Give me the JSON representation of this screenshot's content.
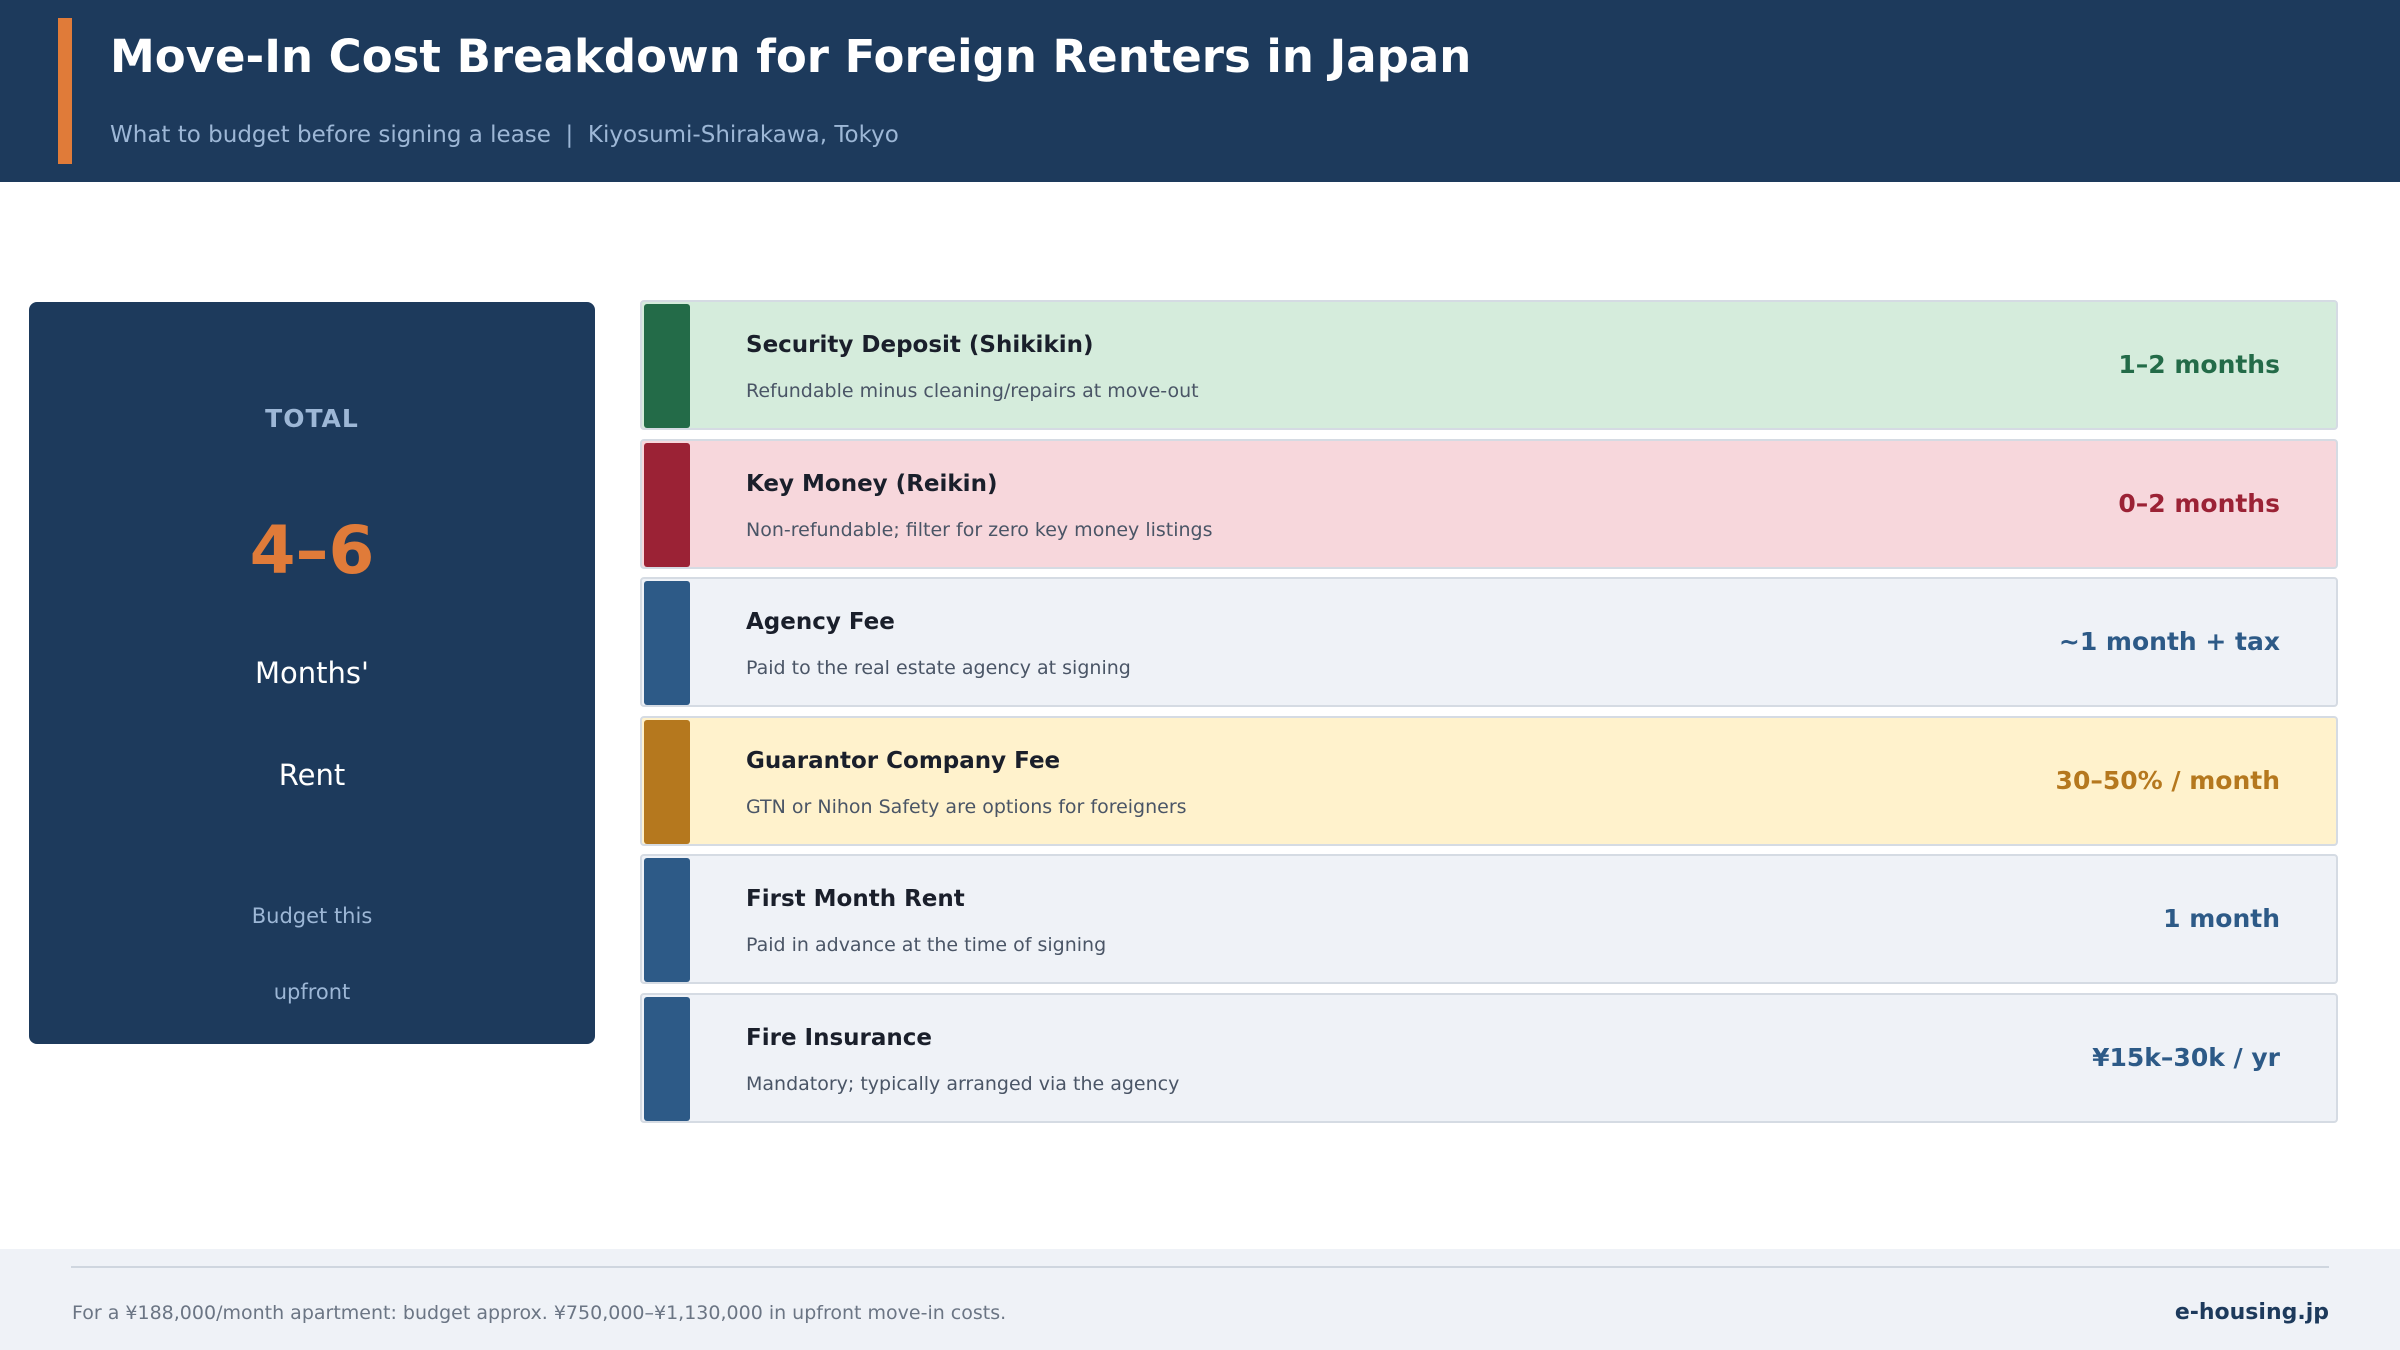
{
  "header": {
    "title": "Move-In Cost Breakdown for Foreign Renters in Japan",
    "subtitle": "What to budget before signing a lease  |  Kiyosumi-Shirakawa, Tokyo",
    "background_color": "#1d3a5c",
    "accent_color": "#e07b39"
  },
  "total": {
    "label": "TOTAL",
    "range": "4–6",
    "unit_line1": "Months'",
    "unit_line2": "Rent",
    "note_line1": "Budget this",
    "note_line2": "upfront",
    "range_color": "#e07b39"
  },
  "costs": [
    {
      "name": "Security Deposit (Shikikin)",
      "description": "Refundable minus cleaning/repairs at move-out",
      "amount": "1–2 months",
      "accent_color": "#236b48",
      "background_color": "#d5ecdc"
    },
    {
      "name": "Key Money (Reikin)",
      "description": "Non-refundable; filter for zero key money listings",
      "amount": "0–2 months",
      "accent_color": "#9b2235",
      "background_color": "#f7d7dc"
    },
    {
      "name": "Agency Fee",
      "description": "Paid to the real estate agency at signing",
      "amount": "~1 month + tax",
      "accent_color": "#2d5a87",
      "background_color": "#eff2f7"
    },
    {
      "name": "Guarantor Company Fee",
      "description": "GTN or Nihon Safety are options for foreigners",
      "amount": "30–50% / month",
      "accent_color": "#b5781e",
      "background_color": "#fff2cc"
    },
    {
      "name": "First Month Rent",
      "description": "Paid in advance at the time of signing",
      "amount": "1 month",
      "accent_color": "#2d5a87",
      "background_color": "#eff2f7"
    },
    {
      "name": "Fire Insurance",
      "description": "Mandatory; typically arranged via the agency",
      "amount": "¥15k–30k / yr",
      "accent_color": "#2d5a87",
      "background_color": "#eff2f7"
    }
  ],
  "footer": {
    "note": "For a ¥188,000/month apartment: budget approx. ¥750,000–¥1,130,000 in upfront move-in costs.",
    "brand": "e-housing.jp"
  }
}
